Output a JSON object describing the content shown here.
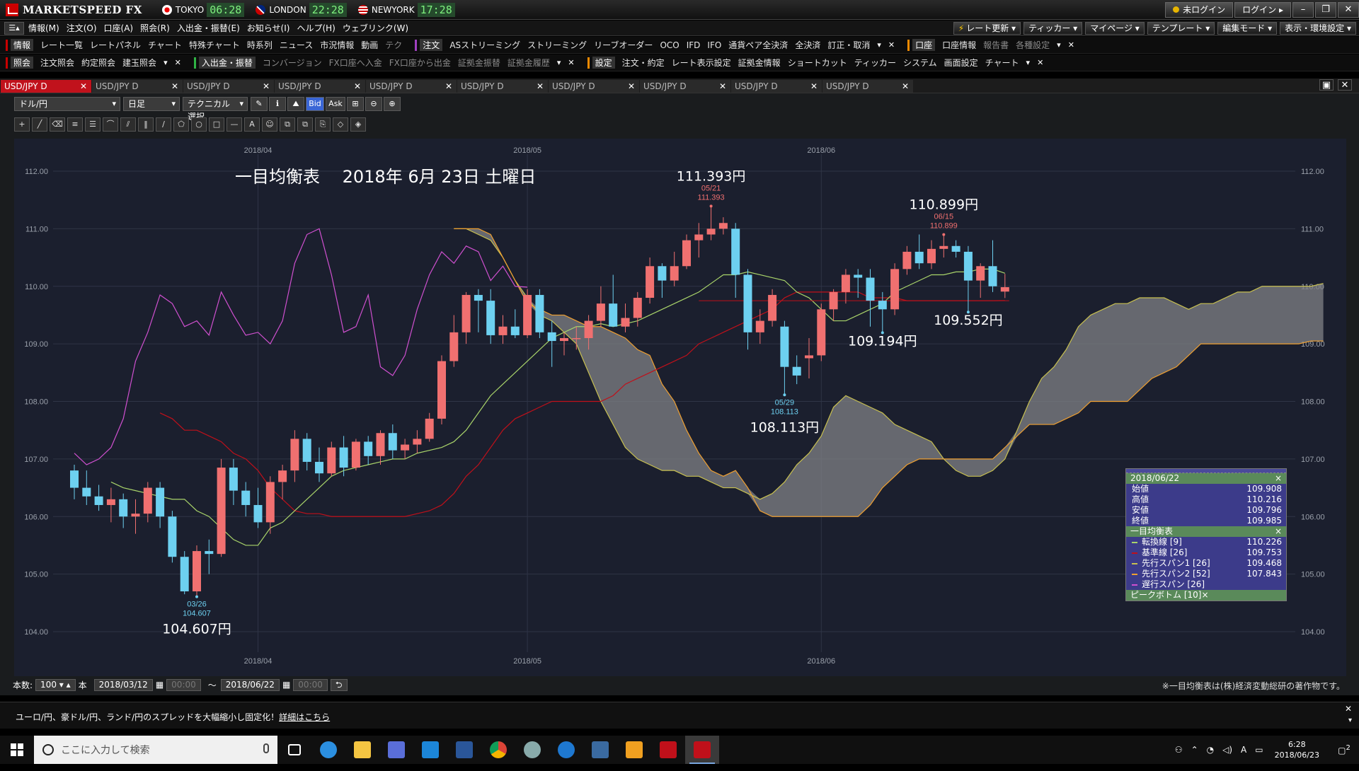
{
  "titlebar": {
    "app_name": "MARKETSPEED FX",
    "clocks": [
      {
        "city": "TOKYO",
        "time": "06:28"
      },
      {
        "city": "LONDON",
        "time": "22:28"
      },
      {
        "city": "NEWYORK",
        "time": "17:28"
      }
    ],
    "status": "未ログイン",
    "login": "ログイン"
  },
  "menubar": {
    "items": [
      "情報(M)",
      "注文(O)",
      "口座(A)",
      "照会(R)",
      "入出金・振替(E)",
      "お知らせ(I)",
      "ヘルプ(H)",
      "ウェブリンク(W)"
    ],
    "right_buttons": [
      "レート更新",
      "ティッカー",
      "マイページ",
      "テンプレート",
      "編集モード",
      "表示・環境設定"
    ]
  },
  "toolrow1": {
    "group1_head": "情報",
    "group1": [
      "レート一覧",
      "レートパネル",
      "チャート",
      "特殊チャート",
      "時系列",
      "ニュース",
      "市況情報",
      "動画",
      "テク"
    ],
    "group2_head": "注文",
    "group2": [
      "ASストリーミング",
      "ストリーミング",
      "リーブオーダー",
      "OCO",
      "IFD",
      "IFO",
      "通貨ペア全決済",
      "全決済",
      "訂正・取消"
    ],
    "group3_head": "口座",
    "group3": [
      "口座情報",
      "報告書",
      "各種設定"
    ]
  },
  "toolrow2": {
    "group1_head": "照会",
    "group1": [
      "注文照会",
      "約定照会",
      "建玉照会"
    ],
    "group2_head": "入出金・振替",
    "group2": [
      "コンバージョン",
      "FX口座へ入金",
      "FX口座から出金",
      "証拠金振替",
      "証拠金履歴"
    ],
    "group3_head": "設定",
    "group3": [
      "注文・約定",
      "レート表示設定",
      "証拠金情報",
      "ショートカット",
      "ティッカー",
      "システム",
      "画面設定",
      "チャート"
    ]
  },
  "tabs": [
    "USD/JPY D",
    "USD/JPY D",
    "USD/JPY D",
    "USD/JPY D",
    "USD/JPY D",
    "USD/JPY D",
    "USD/JPY D",
    "USD/JPY D",
    "USD/JPY D",
    "USD/JPY D"
  ],
  "controls": {
    "pair": "ドル/円",
    "timeframe": "日足",
    "technical": "テクニカル選択",
    "bid": "Bid",
    "ask": "Ask"
  },
  "colors": {
    "bull": "#f07070",
    "bear": "#6dd0f0",
    "tenkan": "#a9d46a",
    "kijun": "#c0101a",
    "span1": "#c8c050",
    "span2": "#f0a030",
    "chikou": "#d050d0",
    "cloud": "#808285"
  },
  "chart_data": {
    "type": "candlestick-ichimoku",
    "title": "一目均衡表　 2018年 6月 23日 土曜日",
    "y_ticks": [
      "112.00",
      "111.00",
      "110.00",
      "109.00",
      "108.00",
      "107.00",
      "106.00",
      "105.00",
      "104.00"
    ],
    "ylim": [
      104.0,
      112.0
    ],
    "x_month_labels": [
      "2018/04",
      "2018/05",
      "2018/06"
    ],
    "x_month_index": [
      15,
      37,
      61
    ],
    "candles": [
      [
        106.8,
        106.9,
        106.3,
        106.5
      ],
      [
        106.5,
        106.8,
        106.2,
        106.35
      ],
      [
        106.35,
        106.55,
        106.1,
        106.2
      ],
      [
        106.2,
        106.5,
        105.9,
        106.3
      ],
      [
        106.3,
        106.4,
        105.8,
        106.0
      ],
      [
        106.0,
        106.3,
        105.7,
        106.05
      ],
      [
        106.05,
        106.6,
        105.9,
        106.5
      ],
      [
        106.5,
        106.6,
        105.8,
        106.0
      ],
      [
        106.0,
        106.1,
        105.2,
        105.3
      ],
      [
        105.3,
        105.4,
        104.65,
        104.7
      ],
      [
        104.7,
        105.5,
        104.607,
        105.4
      ],
      [
        105.4,
        105.6,
        105.0,
        105.35
      ],
      [
        105.35,
        107.0,
        105.3,
        106.85
      ],
      [
        106.85,
        107.0,
        106.2,
        106.45
      ],
      [
        106.45,
        106.6,
        106.0,
        106.2
      ],
      [
        106.2,
        106.5,
        105.8,
        105.9
      ],
      [
        105.9,
        106.7,
        105.7,
        106.6
      ],
      [
        106.6,
        106.9,
        106.3,
        106.8
      ],
      [
        106.8,
        107.5,
        106.6,
        107.35
      ],
      [
        107.35,
        107.45,
        106.8,
        106.95
      ],
      [
        106.95,
        107.2,
        106.6,
        106.75
      ],
      [
        106.75,
        107.3,
        106.7,
        107.2
      ],
      [
        107.2,
        107.4,
        106.7,
        106.85
      ],
      [
        106.85,
        107.35,
        106.8,
        107.3
      ],
      [
        107.3,
        107.4,
        106.9,
        107.05
      ],
      [
        107.05,
        107.5,
        106.9,
        107.45
      ],
      [
        107.45,
        107.6,
        107.0,
        107.15
      ],
      [
        107.15,
        107.35,
        107.0,
        107.25
      ],
      [
        107.25,
        107.5,
        107.1,
        107.35
      ],
      [
        107.35,
        107.8,
        107.3,
        107.7
      ],
      [
        107.7,
        108.8,
        107.6,
        108.7
      ],
      [
        108.7,
        109.5,
        108.6,
        109.2
      ],
      [
        109.2,
        109.9,
        109.0,
        109.85
      ],
      [
        109.85,
        109.95,
        109.2,
        109.75
      ],
      [
        109.75,
        109.95,
        109.0,
        109.15
      ],
      [
        109.15,
        109.5,
        109.0,
        109.3
      ],
      [
        109.3,
        109.6,
        109.1,
        109.15
      ],
      [
        109.15,
        109.95,
        109.1,
        109.85
      ],
      [
        109.85,
        109.95,
        109.1,
        109.2
      ],
      [
        109.2,
        109.4,
        108.6,
        109.05
      ],
      [
        109.05,
        109.2,
        108.8,
        109.1
      ],
      [
        109.1,
        109.3,
        108.9,
        109.1
      ],
      [
        109.1,
        109.5,
        108.9,
        109.4
      ],
      [
        109.4,
        110.0,
        109.3,
        109.7
      ],
      [
        109.7,
        110.2,
        109.3,
        109.3
      ],
      [
        109.3,
        109.7,
        109.2,
        109.45
      ],
      [
        109.45,
        109.9,
        109.3,
        109.8
      ],
      [
        109.8,
        110.5,
        109.7,
        110.35
      ],
      [
        110.35,
        110.4,
        109.8,
        110.1
      ],
      [
        110.1,
        110.6,
        110.0,
        110.35
      ],
      [
        110.35,
        110.9,
        110.3,
        110.8
      ],
      [
        110.8,
        111.1,
        110.5,
        110.9
      ],
      [
        110.9,
        111.393,
        110.8,
        111.0
      ],
      [
        111.0,
        111.2,
        110.9,
        111.1
      ],
      [
        111.0,
        111.1,
        109.8,
        110.2
      ],
      [
        110.2,
        110.3,
        108.9,
        109.2
      ],
      [
        109.2,
        109.6,
        109.0,
        109.4
      ],
      [
        109.4,
        109.95,
        109.3,
        109.85
      ],
      [
        109.3,
        109.4,
        108.113,
        108.6
      ],
      [
        108.6,
        108.8,
        108.3,
        108.45
      ],
      [
        108.75,
        109.1,
        108.4,
        108.8
      ],
      [
        108.8,
        109.7,
        108.7,
        109.6
      ],
      [
        109.6,
        109.95,
        109.4,
        109.9
      ],
      [
        109.9,
        110.3,
        109.7,
        110.2
      ],
      [
        110.2,
        110.3,
        109.8,
        110.15
      ],
      [
        110.15,
        110.3,
        109.3,
        109.75
      ],
      [
        109.75,
        109.9,
        109.194,
        109.6
      ],
      [
        109.6,
        110.4,
        109.5,
        110.3
      ],
      [
        110.3,
        110.7,
        110.2,
        110.6
      ],
      [
        110.6,
        110.9,
        110.3,
        110.4
      ],
      [
        110.4,
        110.8,
        110.3,
        110.65
      ],
      [
        110.65,
        110.899,
        110.5,
        110.7
      ],
      [
        110.7,
        110.8,
        110.5,
        110.6
      ],
      [
        110.6,
        110.7,
        109.552,
        110.1
      ],
      [
        110.1,
        110.4,
        109.8,
        110.35
      ],
      [
        110.35,
        110.8,
        109.9,
        110.0
      ],
      [
        109.908,
        110.216,
        109.796,
        109.985
      ]
    ],
    "tenkan": [
      106.6,
      106.5,
      106.45,
      106.4,
      106.35,
      106.3,
      106.3,
      106.1,
      106.0,
      105.8,
      105.6,
      105.5,
      105.5,
      105.8,
      105.9,
      106.1,
      106.3,
      106.5,
      106.7,
      106.8,
      106.85,
      106.9,
      106.95,
      107.0,
      107.0,
      107.1,
      107.15,
      107.2,
      107.3,
      107.5,
      107.8,
      108.1,
      108.3,
      108.5,
      108.7,
      108.9,
      109.1,
      109.2,
      109.3,
      109.3,
      109.35,
      109.3,
      109.35,
      109.4,
      109.5,
      109.6,
      109.7,
      109.8,
      109.9,
      110.05,
      110.2,
      110.2,
      110.25,
      110.2,
      110.15,
      110.1,
      109.9,
      109.8,
      109.6,
      109.4,
      109.4,
      109.5,
      109.6,
      109.7,
      109.9,
      110.0,
      110.1,
      110.2,
      110.2,
      110.25,
      110.25,
      110.3,
      110.3,
      110.226
    ],
    "kijun": [
      107.8,
      107.7,
      107.5,
      107.5,
      107.4,
      107.3,
      107.1,
      107.0,
      106.8,
      106.5,
      106.3,
      106.1,
      106.05,
      106.05,
      106.0,
      106.0,
      106.0,
      106.0,
      106.0,
      106.0,
      106.0,
      106.05,
      106.1,
      106.2,
      106.4,
      106.7,
      106.9,
      107.2,
      107.5,
      107.7,
      107.8,
      107.9,
      108.0,
      108.0,
      108.0,
      108.0,
      108.0,
      108.1,
      108.3,
      108.4,
      108.5,
      108.6,
      108.7,
      108.8,
      109.0,
      109.1,
      109.2,
      109.3,
      109.4,
      109.5,
      109.6,
      109.8,
      109.9,
      109.9,
      109.9,
      109.9,
      109.9,
      109.9,
      109.8,
      109.8,
      109.8,
      109.75,
      109.75,
      109.75,
      109.75,
      109.75,
      109.75,
      109.75,
      109.75,
      109.753
    ],
    "span1": [
      111.0,
      111.0,
      110.9,
      110.8,
      110.5,
      110.1,
      109.8,
      109.5,
      109.4,
      109.2,
      109.0,
      108.5,
      108.0,
      107.6,
      107.2,
      107.0,
      106.9,
      106.8,
      106.8,
      106.7,
      106.7,
      106.6,
      106.5,
      106.5,
      106.4,
      106.3,
      106.4,
      106.6,
      106.9,
      107.1,
      107.4,
      107.9,
      108.1,
      108.0,
      107.9,
      107.8,
      107.6,
      107.5,
      107.4,
      107.3,
      107.0,
      106.8,
      106.7,
      106.7,
      106.8,
      107.0,
      107.5,
      108.0,
      108.4,
      108.6,
      108.9,
      109.3,
      109.5,
      109.6,
      109.7,
      109.7,
      109.8,
      109.8,
      109.8,
      109.7,
      109.6,
      109.7,
      109.7,
      109.8,
      109.9,
      109.9,
      110.0,
      110.0,
      110.0,
      110.0,
      110.0,
      110.05
    ],
    "span2": [
      111.0,
      111.0,
      111.0,
      110.9,
      110.5,
      110.1,
      109.7,
      109.6,
      109.5,
      109.5,
      109.4,
      109.3,
      109.3,
      109.2,
      109.1,
      108.9,
      108.8,
      108.3,
      108.0,
      107.5,
      107.1,
      106.8,
      106.7,
      106.8,
      106.5,
      106.1,
      106.0,
      106.0,
      106.0,
      106.0,
      106.0,
      106.0,
      106.0,
      106.0,
      106.2,
      106.5,
      106.7,
      106.9,
      107.0,
      107.0,
      107.0,
      107.0,
      107.0,
      107.0,
      107.0,
      107.2,
      107.4,
      107.6,
      107.6,
      107.6,
      107.7,
      107.8,
      108.0,
      108.0,
      108.0,
      108.0,
      108.2,
      108.4,
      108.5,
      108.6,
      108.8,
      109.0,
      109.0,
      109.0,
      109.0,
      109.0,
      109.0,
      109.0,
      109.0,
      109.0,
      109.05,
      109.05
    ],
    "chikou": [
      107.1,
      106.9,
      107.0,
      107.2,
      107.7,
      108.7,
      109.2,
      109.85,
      109.7,
      109.3,
      109.4,
      109.15,
      109.9,
      109.5,
      109.15,
      109.2,
      109.0,
      109.4,
      110.4,
      110.9,
      111.0,
      110.2,
      109.2,
      109.3,
      109.85,
      108.6,
      108.45,
      108.8,
      109.6,
      110.2,
      110.6,
      110.4,
      110.7,
      110.6,
      110.1,
      110.35,
      110.0,
      109.985
    ],
    "annotations": [
      {
        "text": "111.393円",
        "idx": 52,
        "price": 111.393,
        "date": "05/21",
        "val": "111.393",
        "kind": "high"
      },
      {
        "text": "110.899円",
        "idx": 71,
        "price": 110.899,
        "date": "06/15",
        "val": "110.899",
        "kind": "high"
      },
      {
        "text": "104.607円",
        "idx": 10,
        "price": 104.607,
        "date": "03/26",
        "val": "104.607",
        "kind": "low"
      },
      {
        "text": "108.113円",
        "idx": 58,
        "price": 108.113,
        "date": "05/29",
        "val": "108.113",
        "kind": "low"
      },
      {
        "text": "109.194円",
        "idx": 66,
        "price": 109.194,
        "date": "",
        "val": "",
        "kind": "low"
      },
      {
        "text": "109.552円",
        "idx": 73,
        "price": 109.552,
        "date": "",
        "val": "",
        "kind": "low"
      }
    ],
    "kijun_ref": 109.75
  },
  "infopanel": {
    "date": "2018/06/22",
    "ohlc": [
      {
        "label": "始値",
        "value": "109.908"
      },
      {
        "label": "高値",
        "value": "110.216"
      },
      {
        "label": "安値",
        "value": "109.796"
      },
      {
        "label": "終値",
        "value": "109.985"
      }
    ],
    "ichimoku_head": "一目均衡表",
    "ichimoku": [
      {
        "label": "転換線 [9]",
        "value": "110.226"
      },
      {
        "label": "基準線 [26]",
        "value": "109.753"
      },
      {
        "label": "先行スパン1 [26]",
        "value": "109.468"
      },
      {
        "label": "先行スパン2 [52]",
        "value": "107.843"
      },
      {
        "label": "遅行スパン [26]",
        "value": ""
      }
    ],
    "peak_head": "ピークボトム [10]"
  },
  "rangebar": {
    "label_count": "本数:",
    "count": "100",
    "unit": "本",
    "from": "2018/03/12",
    "from_time": "00:00",
    "tilde": "～",
    "to": "2018/06/22",
    "to_time": "00:00",
    "copyright": "※一目均衡表は(株)経済変動総研の著作物です。"
  },
  "news": {
    "text": "ユーロ/円、豪ドル/円、ランド/円のスプレッドを大幅縮小し固定化！",
    "link": "詳細はこちら"
  },
  "taskbar": {
    "search_placeholder": "ここに入力して検索",
    "time": "6:28",
    "date": "2018/06/23",
    "notif_count": "2",
    "ime": "A"
  }
}
